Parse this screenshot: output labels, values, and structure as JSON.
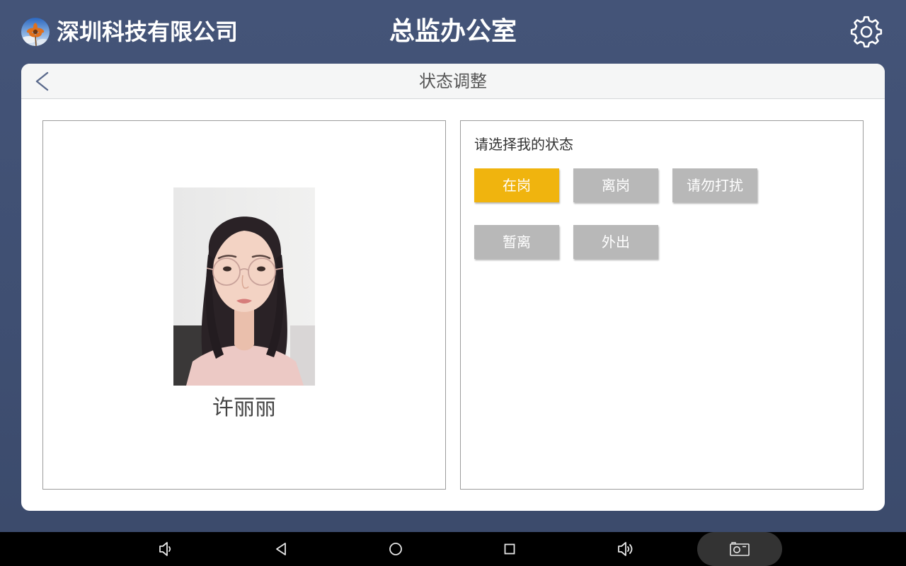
{
  "header": {
    "company_name": "深圳科技有限公司",
    "room_title": "总监办公室"
  },
  "card": {
    "title": "状态调整"
  },
  "profile": {
    "name": "许丽丽"
  },
  "status": {
    "prompt": "请选择我的状态",
    "options": [
      {
        "label": "在岗",
        "selected": true
      },
      {
        "label": "离岗",
        "selected": false
      },
      {
        "label": "请勿打扰",
        "selected": false
      },
      {
        "label": "暂离",
        "selected": false
      },
      {
        "label": "外出",
        "selected": false
      }
    ]
  },
  "icons": {
    "logo": "company-logo-icon",
    "settings": "gear-icon",
    "back": "chevron-left-icon",
    "navbar": [
      "volume-down-icon",
      "back-triangle-icon",
      "home-circle-icon",
      "recents-square-icon",
      "volume-up-icon",
      "screenshot-icon"
    ]
  },
  "colors": {
    "accent": "#f0b40e",
    "inactive": "#b8b8b8",
    "background": "#3f4f72"
  }
}
